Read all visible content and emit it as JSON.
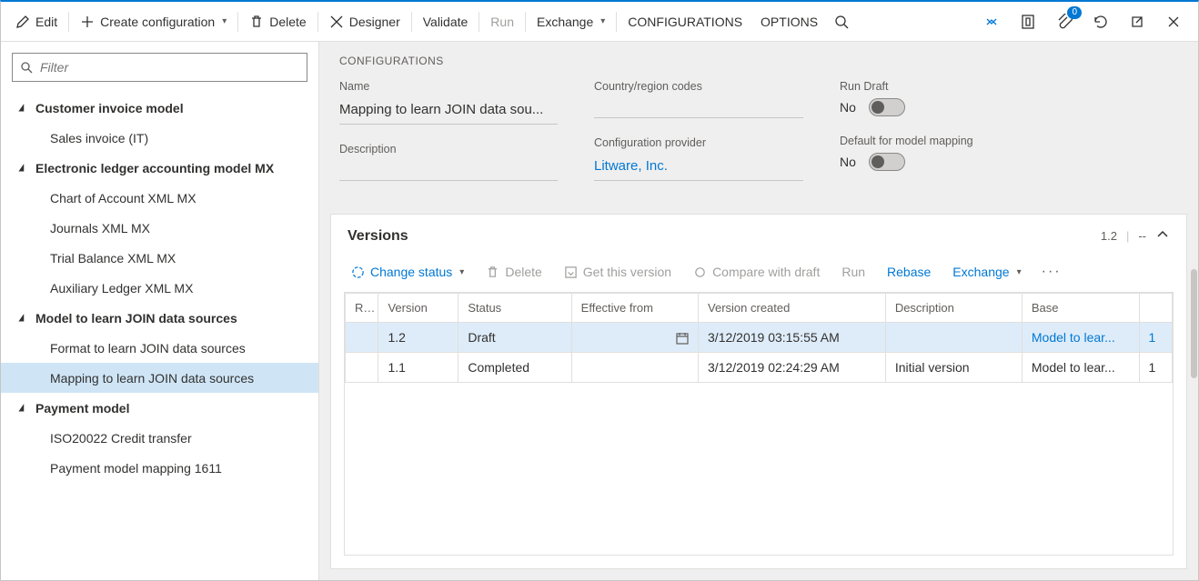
{
  "toolbar": {
    "edit": "Edit",
    "create": "Create configuration",
    "delete": "Delete",
    "designer": "Designer",
    "validate": "Validate",
    "run": "Run",
    "exchange": "Exchange",
    "configurations": "CONFIGURATIONS",
    "options": "OPTIONS",
    "badge": "0"
  },
  "filter": {
    "placeholder": "Filter"
  },
  "tree": [
    {
      "type": "root",
      "label": "Customer invoice model"
    },
    {
      "type": "child",
      "label": "Sales invoice (IT)"
    },
    {
      "type": "root",
      "label": "Electronic ledger accounting model MX"
    },
    {
      "type": "child",
      "label": "Chart of Account XML MX"
    },
    {
      "type": "child",
      "label": "Journals XML MX"
    },
    {
      "type": "child",
      "label": "Trial Balance XML MX"
    },
    {
      "type": "child",
      "label": "Auxiliary Ledger XML MX"
    },
    {
      "type": "root",
      "label": "Model to learn JOIN data sources"
    },
    {
      "type": "child",
      "label": "Format to learn JOIN data sources"
    },
    {
      "type": "child",
      "label": "Mapping to learn JOIN data sources",
      "selected": true
    },
    {
      "type": "root",
      "label": "Payment model"
    },
    {
      "type": "child",
      "label": "ISO20022 Credit transfer"
    },
    {
      "type": "child",
      "label": "Payment model mapping 1611"
    }
  ],
  "config": {
    "section_label": "CONFIGURATIONS",
    "name_label": "Name",
    "name_value": "Mapping to learn JOIN data sou...",
    "description_label": "Description",
    "description_value": "",
    "country_label": "Country/region codes",
    "country_value": "",
    "provider_label": "Configuration provider",
    "provider_value": "Litware, Inc.",
    "run_draft_label": "Run Draft",
    "run_draft_value": "No",
    "default_mapping_label": "Default for model mapping",
    "default_mapping_value": "No"
  },
  "versions": {
    "title": "Versions",
    "current": "1.2",
    "dash": "--",
    "toolbar": {
      "change_status": "Change status",
      "delete": "Delete",
      "get_version": "Get this version",
      "compare": "Compare with draft",
      "run": "Run",
      "rebase": "Rebase",
      "exchange": "Exchange"
    },
    "columns": {
      "r": "R...",
      "version": "Version",
      "status": "Status",
      "effective_from": "Effective from",
      "version_created": "Version created",
      "description": "Description",
      "base": "Base"
    },
    "rows": [
      {
        "r": "",
        "version": "1.2",
        "status": "Draft",
        "effective_from": "",
        "version_created": "3/12/2019 03:15:55 AM",
        "description": "",
        "base": "Model to lear...",
        "base_n": "1",
        "selected": true,
        "show_cal": true
      },
      {
        "r": "",
        "version": "1.1",
        "status": "Completed",
        "effective_from": "",
        "version_created": "3/12/2019 02:24:29 AM",
        "description": "Initial version",
        "base": "Model to lear...",
        "base_n": "1"
      }
    ]
  }
}
